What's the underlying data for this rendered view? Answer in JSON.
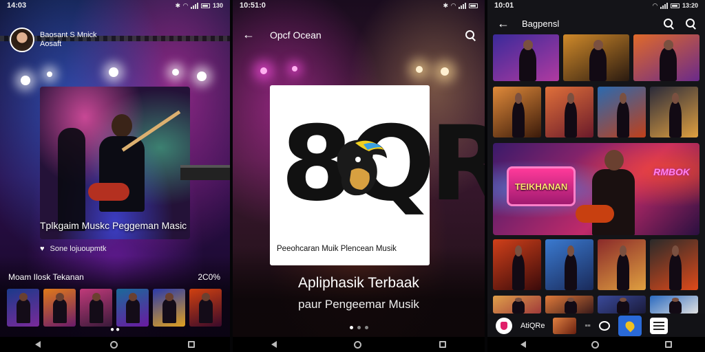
{
  "screen1": {
    "status": {
      "time": "14:03",
      "right": "130"
    },
    "profile": {
      "name": "Baosant S Mnick",
      "subtitle": "Aosaft"
    },
    "hero_title": "Tplkgaim Muskc Peggeman Masic",
    "likes": "Sone lojuoupmtk",
    "section_title": "Moam Ilosk Tekanan",
    "section_value": "2C0%",
    "thumbnails": [
      {
        "color_a": "#1a3a8a",
        "color_b": "#7a2a9a"
      },
      {
        "color_a": "#e07a1a",
        "color_b": "#6a1a6a"
      },
      {
        "color_a": "#c03a7a",
        "color_b": "#3a1a3a"
      },
      {
        "color_a": "#1a6a9a",
        "color_b": "#6a1aa0"
      },
      {
        "color_a": "#2a3aaa",
        "color_b": "#e0a020"
      },
      {
        "color_a": "#d04010",
        "color_b": "#3a0a2a"
      }
    ],
    "pager": "●●"
  },
  "screen2": {
    "status": {
      "time": "10:51:0"
    },
    "title": "Opcf Ocean",
    "logo_text": "8QR",
    "logo_subtitle": "Peeohcaran Muik Plencean Musik",
    "hero_title": "Apliphasik Terbaak",
    "hero_subtitle": "paur Pengeemar Musik",
    "pages": 3,
    "active_page": 0
  },
  "screen3": {
    "status": {
      "time": "10:01",
      "right": "13:20"
    },
    "title": "Bagpensl",
    "row1": [
      {
        "color_a": "#3a2a9a",
        "color_b": "#b03aa0"
      },
      {
        "color_a": "#d08a2a",
        "color_b": "#2a1a10"
      },
      {
        "color_a": "#e06a2a",
        "color_b": "#6a2a8a"
      }
    ],
    "row2": [
      {
        "color_a": "#e08a3a",
        "color_b": "#3a1a0a"
      },
      {
        "color_a": "#e0703a",
        "color_b": "#6a1a2a"
      },
      {
        "color_a": "#2a6ab0",
        "color_b": "#c0401a"
      },
      {
        "color_a": "#2a2a3a",
        "color_b": "#e0a040"
      }
    ],
    "banner": {
      "badge": "TEIKHANAN",
      "side": "RMBOK"
    },
    "row4": [
      {
        "color_a": "#d0401a",
        "color_b": "#3a0a0a"
      },
      {
        "color_a": "#3a7ad0",
        "color_b": "#1a2a5a"
      },
      {
        "color_a": "#8a2a2a",
        "color_b": "#e0a040"
      },
      {
        "color_a": "#2a2a2a",
        "color_b": "#e04a1a"
      }
    ],
    "row5": [
      {
        "color_a": "#e0a04a",
        "color_b": "#a03a3a"
      },
      {
        "color_a": "#e07a3a",
        "color_b": "#3a1a1a"
      },
      {
        "color_a": "#3a4a9a",
        "color_b": "#1a1a3a"
      },
      {
        "color_a": "#2a6ac0",
        "color_b": "#e0e0e0"
      }
    ],
    "bottom": {
      "label": "AtiQRe"
    }
  }
}
